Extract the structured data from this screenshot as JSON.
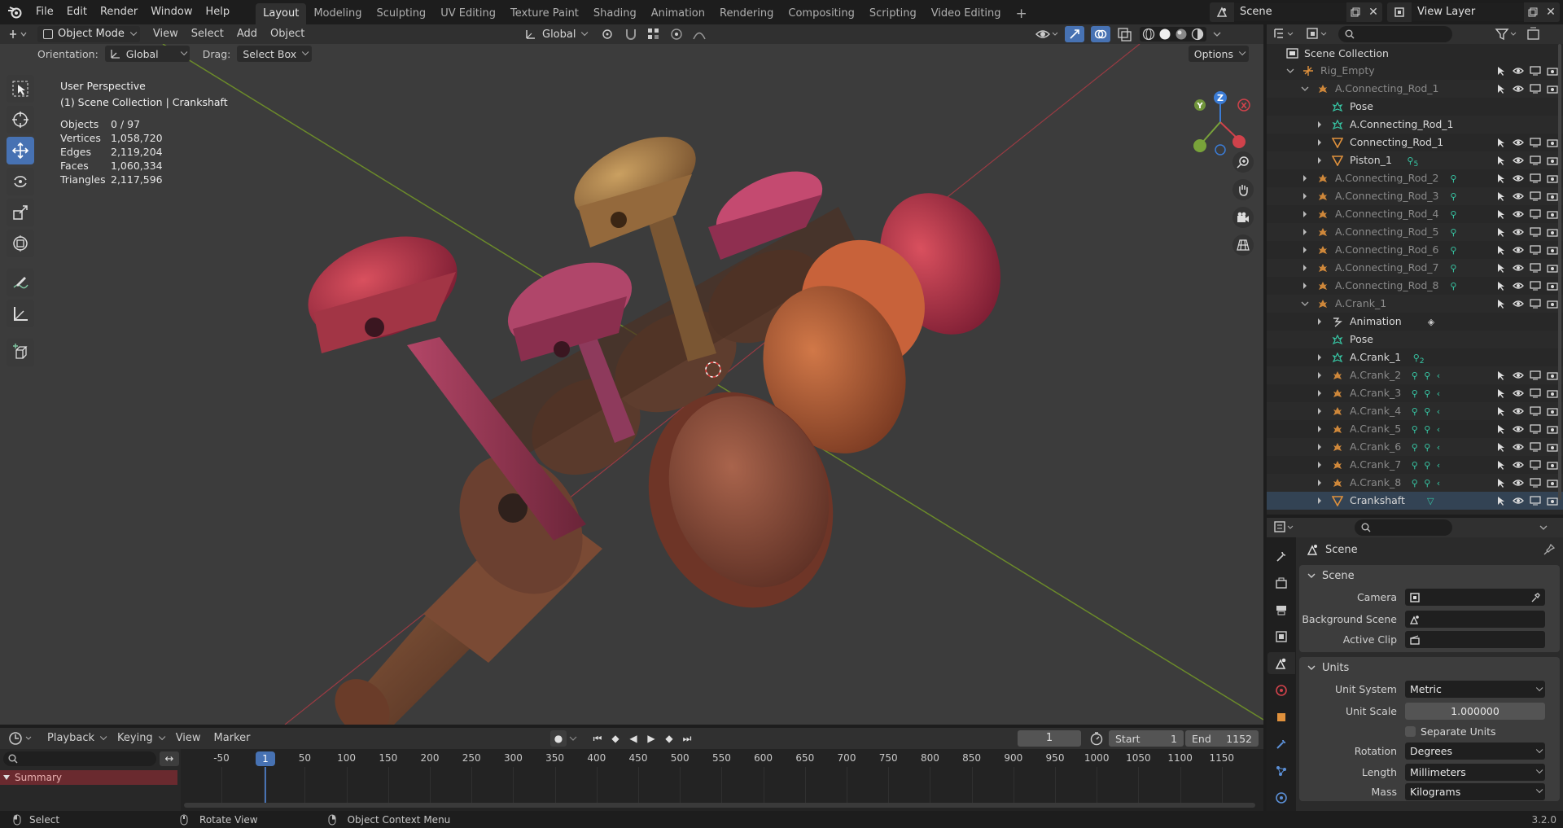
{
  "topbar": {
    "menus": [
      "File",
      "Edit",
      "Render",
      "Window",
      "Help"
    ],
    "workspaces": [
      "Layout",
      "Modeling",
      "Sculpting",
      "UV Editing",
      "Texture Paint",
      "Shading",
      "Animation",
      "Rendering",
      "Compositing",
      "Scripting",
      "Video Editing"
    ],
    "active_workspace": "Layout",
    "add_workspace": "+",
    "scene": "Scene",
    "view_layer": "View Layer"
  },
  "viewport_header": {
    "mode": "Object Mode",
    "menus": [
      "View",
      "Select",
      "Add",
      "Object"
    ],
    "transform_orientation": "Global"
  },
  "tool_settings": {
    "orientation_label": "Orientation:",
    "orientation_value": "Global",
    "drag_label": "Drag:",
    "drag_value": "Select Box",
    "options": "Options"
  },
  "viewport": {
    "view_name": "User Perspective",
    "context": "(1) Scene Collection | Crankshaft",
    "stats": [
      {
        "label": "Objects",
        "value": "0 / 97"
      },
      {
        "label": "Vertices",
        "value": "1,058,720"
      },
      {
        "label": "Edges",
        "value": "2,119,204"
      },
      {
        "label": "Faces",
        "value": "1,060,334"
      },
      {
        "label": "Triangles",
        "value": "2,117,596"
      }
    ],
    "gizmo_axes": [
      "X",
      "Y",
      "Z"
    ]
  },
  "outliner": {
    "root": "Scene Collection",
    "rows": [
      {
        "name": "Rig_Empty",
        "dim": true
      },
      {
        "name": "A.Connecting_Rod_1",
        "dim": true
      },
      {
        "name": "Pose",
        "dim": false
      },
      {
        "name": "A.Connecting_Rod_1",
        "dim": false
      },
      {
        "name": "Connecting_Rod_1",
        "dim": false
      },
      {
        "name": "Piston_1",
        "dim": false,
        "badge": "5"
      },
      {
        "name": "A.Connecting_Rod_2",
        "dim": true
      },
      {
        "name": "A.Connecting_Rod_3",
        "dim": true
      },
      {
        "name": "A.Connecting_Rod_4",
        "dim": true
      },
      {
        "name": "A.Connecting_Rod_5",
        "dim": true
      },
      {
        "name": "A.Connecting_Rod_6",
        "dim": true
      },
      {
        "name": "A.Connecting_Rod_7",
        "dim": true
      },
      {
        "name": "A.Connecting_Rod_8",
        "dim": true
      },
      {
        "name": "A.Crank_1",
        "dim": true
      },
      {
        "name": "Animation",
        "dim": false
      },
      {
        "name": "Pose",
        "dim": false
      },
      {
        "name": "A.Crank_1",
        "dim": false,
        "badge": "2"
      },
      {
        "name": "A.Crank_2",
        "dim": true
      },
      {
        "name": "A.Crank_3",
        "dim": true
      },
      {
        "name": "A.Crank_4",
        "dim": true
      },
      {
        "name": "A.Crank_5",
        "dim": true
      },
      {
        "name": "A.Crank_6",
        "dim": true
      },
      {
        "name": "A.Crank_7",
        "dim": true
      },
      {
        "name": "A.Crank_8",
        "dim": true
      },
      {
        "name": "Crankshaft",
        "dim": false
      }
    ]
  },
  "properties": {
    "breadcrumb": "Scene",
    "scene_panel": "Scene",
    "camera_label": "Camera",
    "background_label": "Background Scene",
    "clip_label": "Active Clip",
    "units_panel": "Units",
    "unit_system_label": "Unit System",
    "unit_system": "Metric",
    "unit_scale_label": "Unit Scale",
    "unit_scale": "1.000000",
    "separate_units": "Separate Units",
    "rotation_label": "Rotation",
    "rotation": "Degrees",
    "length_label": "Length",
    "length": "Millimeters",
    "mass_label": "Mass",
    "mass": "Kilograms"
  },
  "timeline": {
    "menus": [
      "Playback",
      "Keying",
      "View",
      "Marker"
    ],
    "current_frame": "1",
    "start_label": "Start",
    "start": "1",
    "end_label": "End",
    "end": "1152",
    "ticks": [
      "-50",
      "1",
      "50",
      "100",
      "150",
      "200",
      "250",
      "300",
      "350",
      "400",
      "450",
      "500",
      "550",
      "600",
      "650",
      "700",
      "750",
      "800",
      "850",
      "900",
      "950",
      "1000",
      "1050",
      "1100",
      "1150"
    ],
    "summary": "Summary"
  },
  "statusbar": {
    "select": "Select",
    "rotate": "Rotate View",
    "context_menu": "Object Context Menu",
    "version": "3.2.0"
  },
  "colors": {
    "accent": "#4772b3",
    "x_axis": "#d0424b",
    "y_axis": "#79a33a",
    "z_axis": "#3b7cd6",
    "outliner_icon_orange": "#e0913c",
    "outliner_icon_teal": "#37c7a5"
  }
}
